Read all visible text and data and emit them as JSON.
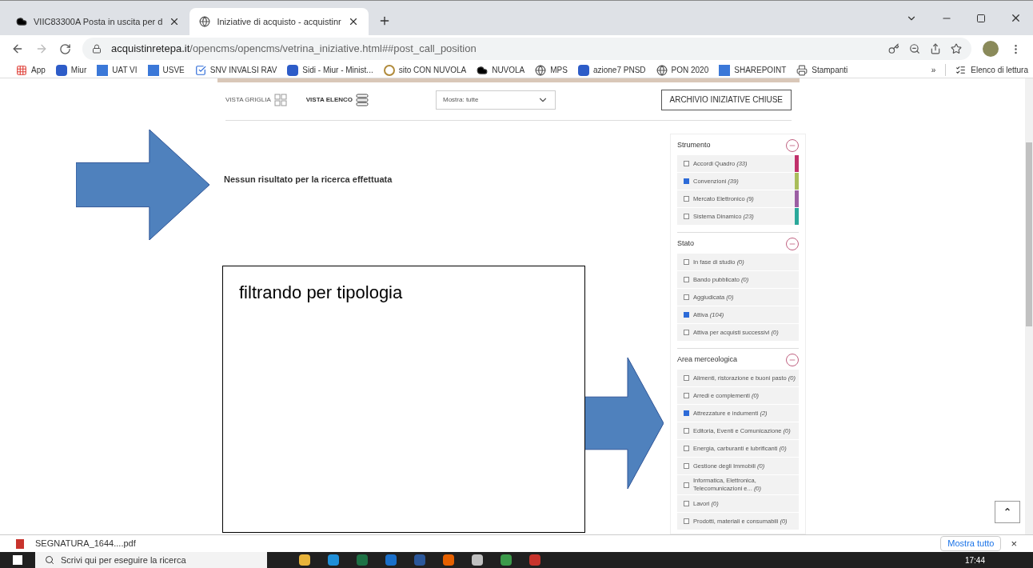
{
  "browser": {
    "tabs": [
      {
        "title": "VIIC83300A Posta in uscita per d",
        "selected": false
      },
      {
        "title": "Iniziative di acquisto - acquistinr",
        "selected": true
      }
    ],
    "url_domain": "acquistinretepa.it",
    "url_path": "/opencms/opencms/vetrina_iniziative.html##post_call_position",
    "bookmarks": [
      "App",
      "Miur",
      "UAT VI",
      "USVE",
      "SNV INVALSI RAV",
      "Sidi - Miur - Minist...",
      "sito CON NUVOLA",
      "NUVOLA",
      "MPS",
      "azione7 PNSD",
      "PON 2020",
      "SHAREPOINT",
      "Stampanti"
    ],
    "more": "»",
    "reading_list": "Elenco di lettura"
  },
  "toolbar": {
    "grid_view": "VISTA GRIGLIA",
    "list_view": "VISTA ELENCO",
    "filter_select": "Mostra: tutte",
    "archive_button": "ARCHIVIO INIZIATIVE CHIUSE"
  },
  "result_message": "Nessun risultato per la ricerca effettuata",
  "filters": [
    {
      "title": "Strumento",
      "expanded": true,
      "items": [
        {
          "label": "Accordi Quadro *(33)*",
          "checked": false,
          "color": "#c0306a"
        },
        {
          "label": "Convenzioni *(39)*",
          "checked": true,
          "color": "#a9bd5a"
        },
        {
          "label": "Mercato Elettronico *(9)*",
          "checked": false,
          "color": "#9b5fa3"
        },
        {
          "label": "Sistema Dinamico *(23)*",
          "checked": false,
          "color": "#2aa89a"
        }
      ]
    },
    {
      "title": "Stato",
      "expanded": true,
      "items": [
        {
          "label": "In fase di studio *(0)*",
          "checked": false
        },
        {
          "label": "Bando pubblicato *(0)*",
          "checked": false
        },
        {
          "label": "Aggiudicata *(0)*",
          "checked": false
        },
        {
          "label": "Attiva *(104)*",
          "checked": true
        },
        {
          "label": "Attiva per acquisti successivi *(0)*",
          "checked": false
        }
      ]
    },
    {
      "title": "Area merceologica",
      "expanded": true,
      "items": [
        {
          "label": "Alimenti, ristorazione e buoni pasto *(0)*",
          "checked": false
        },
        {
          "label": "Arredi e complementi *(0)*",
          "checked": false
        },
        {
          "label": "Attrezzature e indumenti *(2)*",
          "checked": true
        },
        {
          "label": "Editoria, Eventi e Comunicazione *(0)*",
          "checked": false
        },
        {
          "label": "Energia, carburanti e lubrificanti *(0)*",
          "checked": false
        },
        {
          "label": "Gestione degli Immobili *(0)*",
          "checked": false
        },
        {
          "label": "Informatica, Elettronica, Telecomunicazioni e... *(0)*",
          "checked": false
        },
        {
          "label": "Lavori *(0)*",
          "checked": false
        },
        {
          "label": "Prodotti, materiali e consumabili *(0)*",
          "checked": false
        }
      ]
    }
  ],
  "annotation": "filtrando per tipologia",
  "scroll_top": "⌃",
  "download_bar": {
    "file": "SEGNATURA_1644....pdf",
    "show_all": "Mostra tutto",
    "close": "×"
  },
  "taskbar": {
    "search_placeholder": "Scrivi qui per eseguire la ricerca",
    "time": "17:44"
  }
}
